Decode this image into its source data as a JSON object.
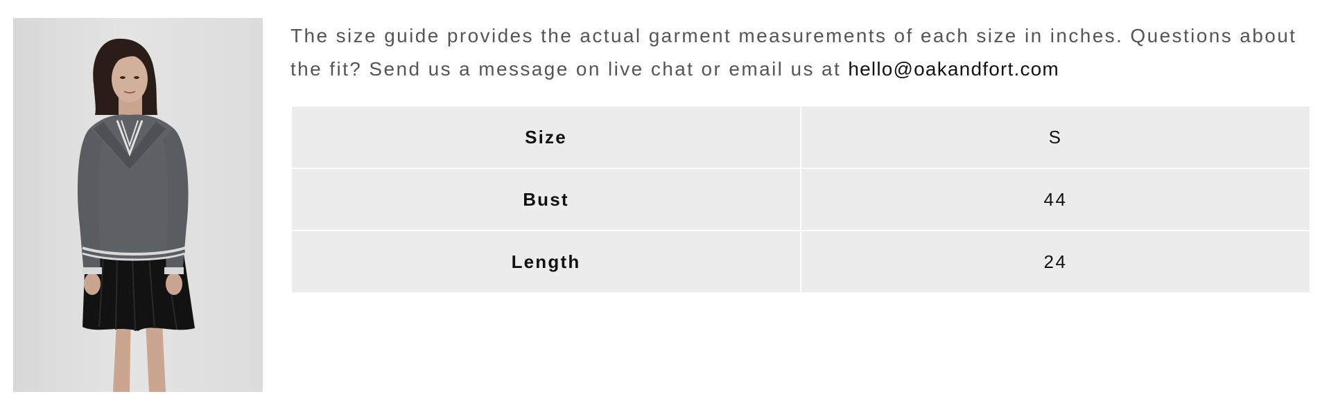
{
  "product": {
    "image_alt": "Model wearing a grey knit collared sweater with white striped trim and a black pleated mini skirt"
  },
  "intro": {
    "text": "The size guide provides the actual garment measurements of each size in inches. Questions about the fit? Send us a message on live chat or email us at ",
    "email": "hello@oakandfort.com"
  },
  "size_table": {
    "rows": [
      {
        "label": "Size",
        "value": "S"
      },
      {
        "label": "Bust",
        "value": "44"
      },
      {
        "label": "Length",
        "value": "24"
      }
    ]
  },
  "colors": {
    "table_cell_bg": "#ececec",
    "body_text": "#555555",
    "link_text": "#111111",
    "sweater": "#5e6165",
    "skirt": "#121212"
  }
}
